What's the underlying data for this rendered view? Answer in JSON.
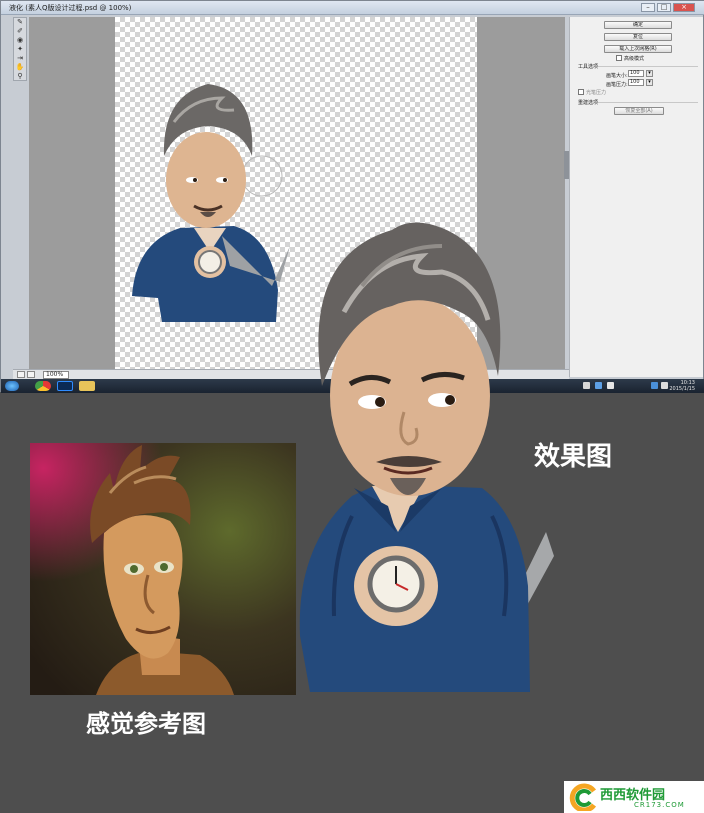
{
  "ps_window": {
    "title": "液化 (素人Q版设计过程.psd @ 100%)",
    "window_buttons": [
      "–",
      "□",
      "×"
    ],
    "tools": [
      "forward-warp-icon",
      "reconstruct-icon",
      "pucker-icon",
      "bloat-icon",
      "push-left-icon",
      "hand-icon",
      "zoom-icon"
    ],
    "zoom": "100%"
  },
  "panel": {
    "ok_label": "确定",
    "reset_label": "复位",
    "load_mesh_label": "载入上次网格(R)",
    "advanced_mode_label": "高级模式",
    "tool_options_label": "工具选项",
    "brush_size_label": "画笔大小:",
    "brush_size_value": "100",
    "brush_pressure_label": "画笔压力:",
    "brush_pressure_value": "100",
    "stylus_label": "光笔压力",
    "rebuild_options_label": "重建选项",
    "restore_all_label": "恢复全部(A)"
  },
  "taskbar": {
    "time": "10:13",
    "date": "2015/1/15"
  },
  "captions": {
    "result": "效果图",
    "reference": "感觉参考图"
  },
  "watermark": {
    "name": "西西软件园",
    "url": "CR173.COM"
  },
  "colors": {
    "background": "#4e4e4e",
    "watermark_green": "#1f9a36",
    "shirt_blue": "#244a7c"
  }
}
